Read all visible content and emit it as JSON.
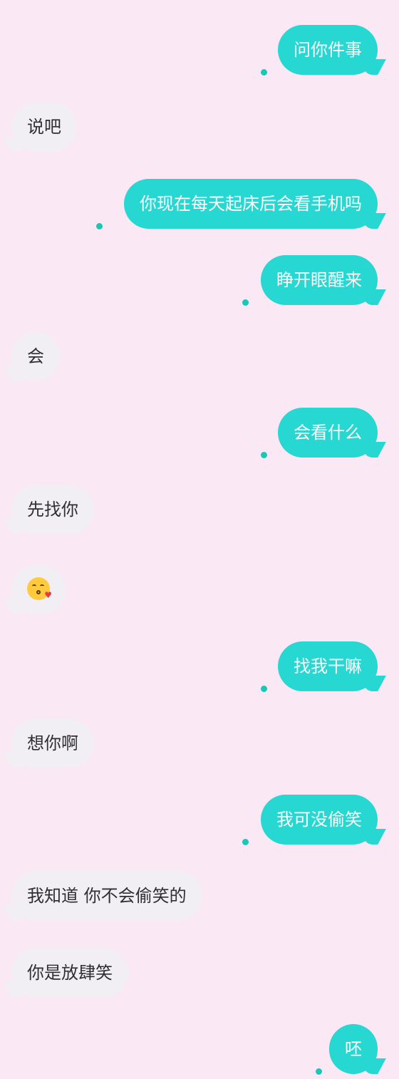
{
  "colors": {
    "background": "#fbe8f5",
    "outgoing_bubble": "#26d7d2",
    "incoming_bubble": "#f1eff4",
    "status_dot": "#19c7b7"
  },
  "messages": [
    {
      "side": "out",
      "text": "问你件事"
    },
    {
      "side": "in",
      "text": "说吧"
    },
    {
      "side": "out",
      "text": "你现在每天起床后会看手机吗"
    },
    {
      "side": "out",
      "text": "睁开眼醒来"
    },
    {
      "side": "in",
      "text": "会"
    },
    {
      "side": "out",
      "text": "会看什么"
    },
    {
      "side": "in",
      "text": "先找你"
    },
    {
      "side": "in",
      "emoji": "kissing-face-emoji"
    },
    {
      "side": "out",
      "text": "找我干嘛"
    },
    {
      "side": "in",
      "text": "想你啊"
    },
    {
      "side": "out",
      "text": "我可没偷笑"
    },
    {
      "side": "in",
      "text": "我知道 你不会偷笑的"
    },
    {
      "side": "in",
      "text": "你是放肆笑"
    },
    {
      "side": "out",
      "text": "呸"
    }
  ]
}
